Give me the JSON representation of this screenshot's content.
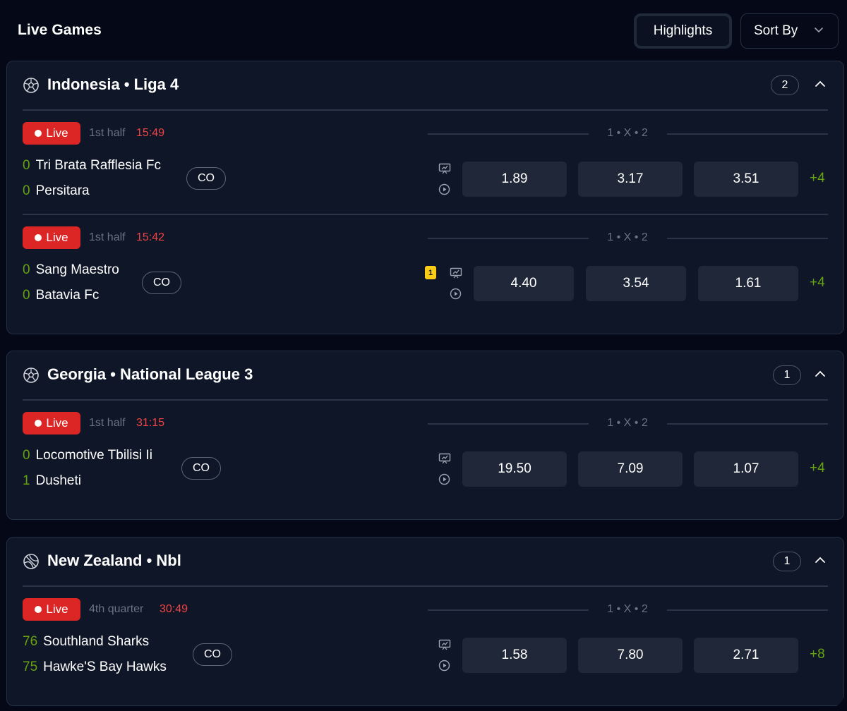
{
  "header": {
    "title": "Live Games",
    "highlights_label": "Highlights",
    "sort_label": "Sort By"
  },
  "colors": {
    "background": "#050816",
    "card": "#0f1628",
    "live_badge": "#dc2626",
    "clock": "#ef4444",
    "score": "#65a30d",
    "odd_button": "#1f2738",
    "boost_badge": "#facc15"
  },
  "leagues": [
    {
      "icon": "soccer-ball-icon",
      "title": "Indonesia • Liga 4",
      "count": "2",
      "matches": [
        {
          "live_label": "Live",
          "period": "1st half",
          "clock": "15:49",
          "market": "1 • X • 2",
          "home": {
            "score": "0",
            "name": "Tri Brata Rafflesia Fc"
          },
          "away": {
            "score": "0",
            "name": "Persitara"
          },
          "co_label": "CO",
          "boost": "",
          "odds": [
            "1.89",
            "3.17",
            "3.51"
          ],
          "more": "+4"
        },
        {
          "live_label": "Live",
          "period": "1st half",
          "clock": "15:42",
          "market": "1 • X • 2",
          "home": {
            "score": "0",
            "name": "Sang Maestro"
          },
          "away": {
            "score": "0",
            "name": "Batavia Fc"
          },
          "co_label": "CO",
          "boost": "1",
          "odds": [
            "4.40",
            "3.54",
            "1.61"
          ],
          "more": "+4"
        }
      ]
    },
    {
      "icon": "soccer-ball-icon",
      "title": "Georgia • National League 3",
      "count": "1",
      "matches": [
        {
          "live_label": "Live",
          "period": "1st half",
          "clock": "31:15",
          "market": "1 • X • 2",
          "home": {
            "score": "0",
            "name": "Locomotive Tbilisi Ii"
          },
          "away": {
            "score": "1",
            "name": "Dusheti"
          },
          "co_label": "CO",
          "boost": "",
          "odds": [
            "19.50",
            "7.09",
            "1.07"
          ],
          "more": "+4"
        }
      ]
    },
    {
      "icon": "basketball-icon",
      "title": "New Zealand • Nbl",
      "count": "1",
      "matches": [
        {
          "live_label": "Live",
          "period": "4th quarter",
          "clock": "30:49",
          "market": "1 • X • 2",
          "home": {
            "score": "76",
            "name": "Southland Sharks"
          },
          "away": {
            "score": "75",
            "name": "Hawke'S Bay Hawks"
          },
          "co_label": "CO",
          "boost": "",
          "odds": [
            "1.58",
            "7.80",
            "2.71"
          ],
          "more": "+8"
        }
      ]
    }
  ]
}
